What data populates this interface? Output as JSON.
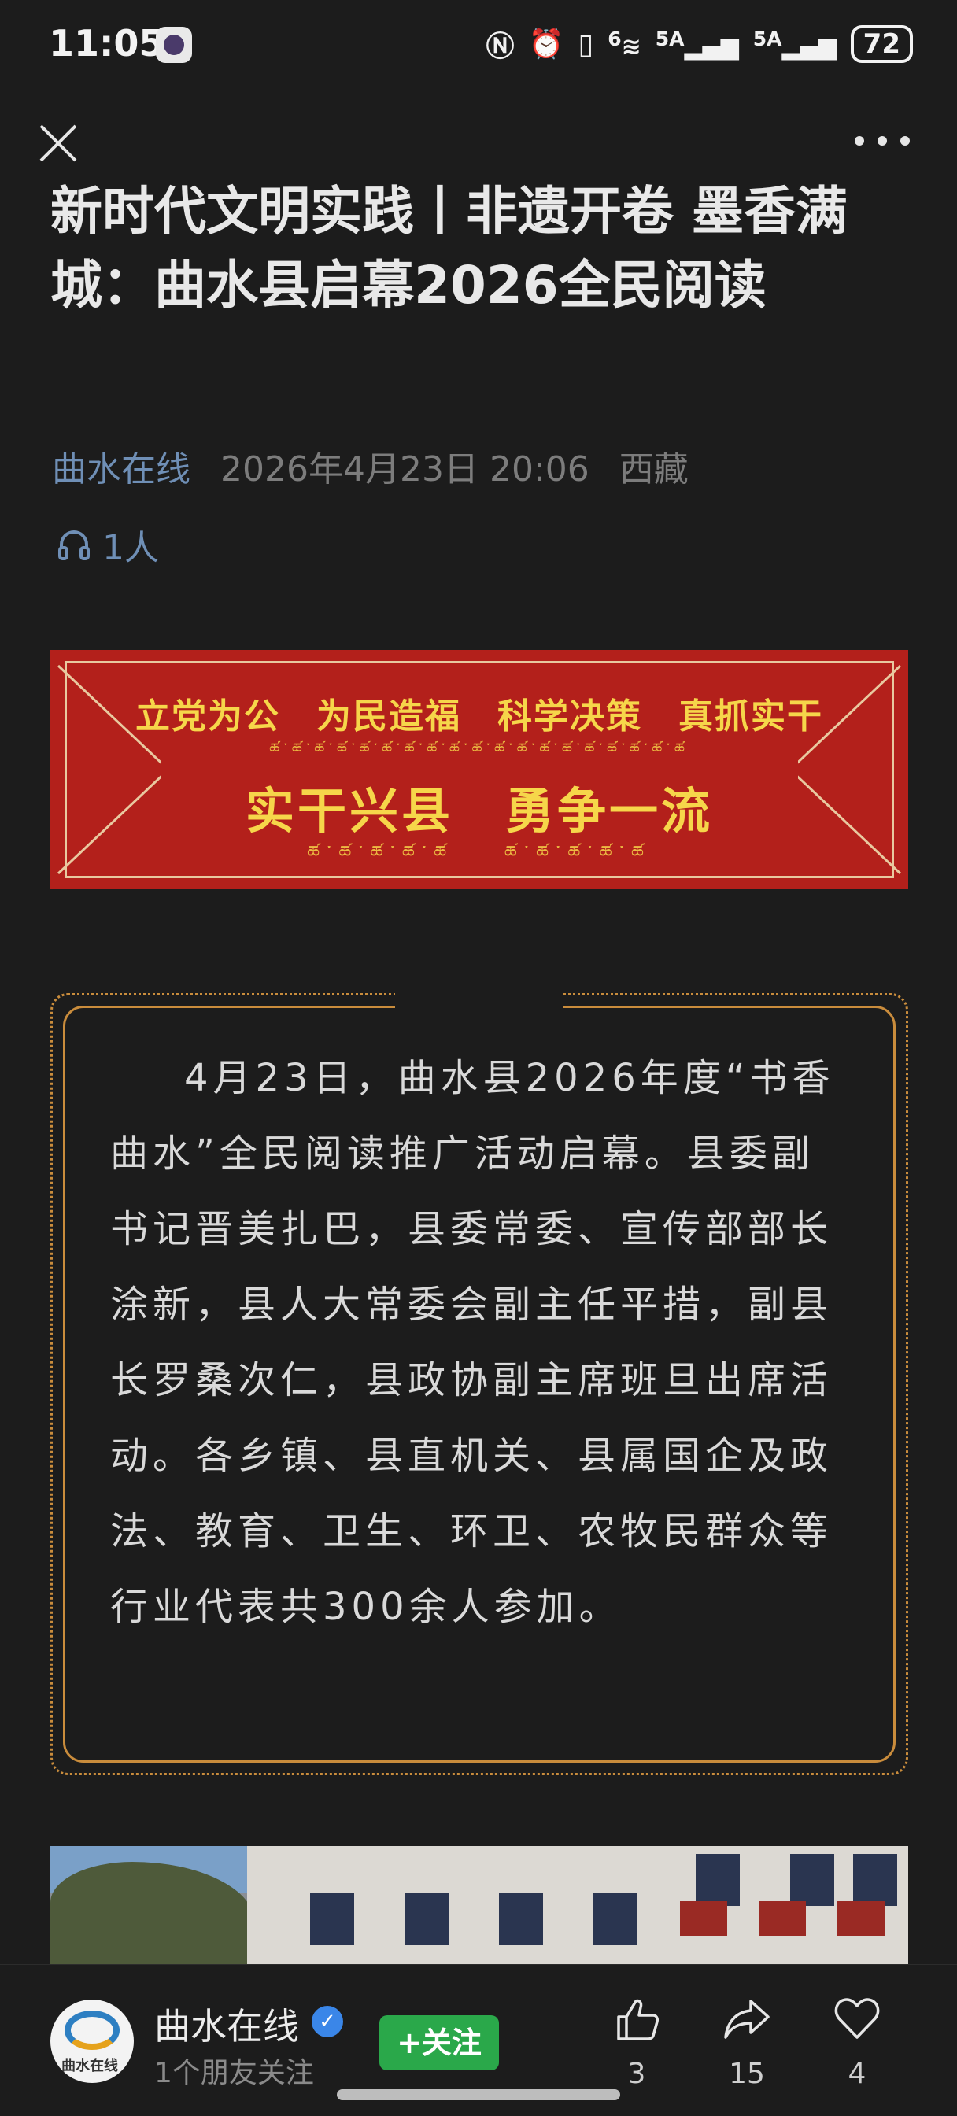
{
  "status_bar": {
    "time": "11:05",
    "battery": "72",
    "signal_1_label": "5A",
    "signal_2_label": "5A",
    "wifi_label": "6"
  },
  "nav": {
    "close_icon": "close-icon",
    "more_icon": "more-dots-icon"
  },
  "article": {
    "title": "新时代文明实践丨非遗开卷 墨香满城：曲水县启幕2026全民阅读",
    "source": "曲水在线",
    "date": "2026年4月23日 20:06",
    "region": "西藏",
    "listeners": "1人"
  },
  "banner": {
    "line1": "立党为公　为民造福　科学决策　真抓实干",
    "line2": "实干兴县　勇争一流",
    "bg_color": "#b3201b",
    "text_color": "#f6d64a"
  },
  "body_text": "4月23日，曲水县2026年度“书香曲水”全民阅读推广活动启幕。县委副书记晋美扎巴，县委常委、宣传部部长涂新，县人大常委会副主任平措，副县长罗桑次仁，县政协副主席班旦出席活动。各乡镇、县直机关、县属国企及政法、教育、卫生、环卫、农牧民群众等行业代表共300余人参加。",
  "bottom_bar": {
    "account_name": "曲水在线",
    "account_sub": "1个朋友关注",
    "follow_label": "+关注",
    "like_count": "3",
    "share_count": "15",
    "favorite_count": "4",
    "follow_color": "#2aa84a"
  }
}
